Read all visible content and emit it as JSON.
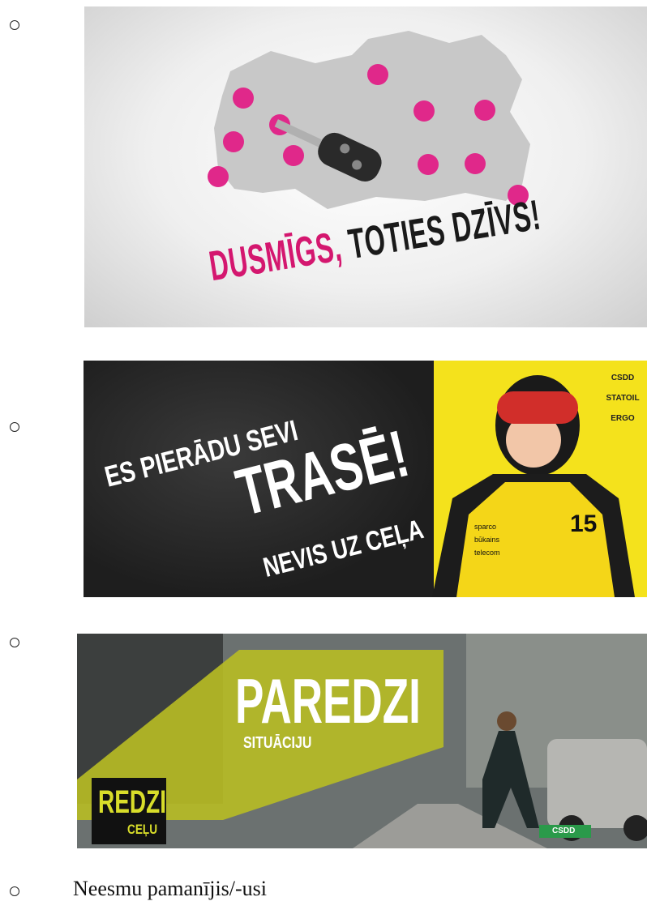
{
  "options": [
    {
      "banner": {
        "slogan_part1": "DUSMĪGS,",
        "slogan_part2": "TOTIES DZĪVS!"
      },
      "colors": {
        "accent": "#d4176f"
      }
    },
    {
      "banner": {
        "line1": "ES PIERĀDU SEVI",
        "line2": "TRASĒ!",
        "line3": "NEVIS UZ CEĻA",
        "sponsors": [
          "CSDD",
          "STATOIL",
          "ERGO"
        ],
        "suit_number": "15",
        "suit_brands": [
          "sparco",
          "būkains",
          "telecom"
        ]
      },
      "colors": {
        "accent": "#f4e21c"
      }
    },
    {
      "banner": {
        "main": "PAREDZI",
        "sub": "SITUĀCIJU",
        "corner_main": "REDZI",
        "corner_sub": "CEĻU",
        "logo": "CSDD"
      },
      "colors": {
        "accent": "#b8bd24"
      }
    },
    {
      "label": "Neesmu pamanījis/-usi"
    }
  ]
}
